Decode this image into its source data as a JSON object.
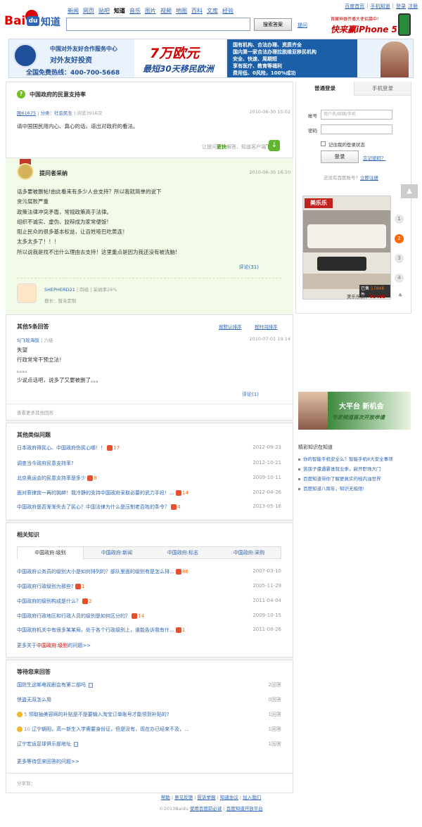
{
  "header": {
    "logo_text": "Bai",
    "logo_du": "du",
    "logo_zhidao": "知道",
    "nav": [
      "新闻",
      "网页",
      "贴吧",
      "知道",
      "音乐",
      "图片",
      "视频",
      "地图",
      "百科",
      "文库",
      "经验"
    ],
    "nav_current": "知道",
    "search_button": "搜索答案",
    "ask_link": "提问",
    "top_links": [
      "百度首页",
      "手机知道",
      "登录",
      "注册"
    ],
    "promo_line1": "首藏神器传播大使招募中!",
    "promo_line2": "快来赢iPhone 5"
  },
  "banner": {
    "line1": "中国对外友好合作服务中心",
    "line2": "对外友好投资",
    "hotline": "全国免费热线：400-700-5668",
    "big": "7万欧元",
    "sub": "最短30天移民欧洲",
    "right_lines": [
      "国有机构、合法办理、资质齐全",
      "国内第一家合法办理拉脱维亚移民机构",
      "安全、快速、周期短",
      "享有医疗、教育等福利",
      "费用低、0风险，100%成功"
    ]
  },
  "question": {
    "title": "中国政府的民意支持率",
    "asker": "刚61675",
    "category": "分类：社会民生",
    "views": "浏览3916次",
    "date": "2010-06-30 15:02",
    "body": "请中国国民用内心、真心的话，道出对政府的看法。",
    "prompt_prefix": "让提问",
    "prompt_fast": "更快",
    "prompt_mid": "解答，知道客户端",
    "prompt_download": "下载"
  },
  "best_answer": {
    "label": "提问者采纳",
    "date": "2010-06-30 16:10",
    "lines": [
      "话多要被删帖!由此看来有多少人会支持？所以我就简单的说下",
      "贪污腐败严重",
      "政策法律冲突矛盾，常规政策高于法律。",
      "组织不诚实、虚伪、狡辩成为家常便饭!",
      "阻止民众的很多基本权益，让百姓哑巴吃黄连！",
      "太多太多了！！！",
      "所以说我是找不出什么理由去支持！这里重点是因为我还没有被洗脑!"
    ],
    "comments": "评论(31)",
    "user": "SHEPHERD21",
    "level": "四级",
    "accept_rate": "采纳率26%",
    "specialty": "擅长：暂未定制"
  },
  "other_answers": {
    "title": "其他5条回答",
    "sort1": "按默认排序",
    "sort2": "按时间排序",
    "user": "SJ飞轮海饭",
    "level": "六级",
    "date": "2010-07-01 19:14",
    "lines": [
      "失望",
      "行政常常干预立法！",
      "。。。。",
      "少说点话吧，说多了又要被删了。。。"
    ],
    "comments": "评论(1)",
    "more": "查看更多其他回答"
  },
  "similar": {
    "title": "其他类似问题",
    "items": [
      {
        "text": "日本政府得民心、中国政府伤民心哪！！",
        "count": "17",
        "date": "2012-09-23"
      },
      {
        "text": "调查当今政府民意支持率?",
        "count": "",
        "date": "2012-10-21"
      },
      {
        "text": "北京奥运会的民意支持率是多少",
        "count": "8",
        "date": "2009-10-11"
      },
      {
        "text": "面对菲律宾一再的挑衅！我冷静的支持中国政府采取必要的武力手段！...",
        "count": "14",
        "date": "2012-04-26"
      },
      {
        "text": "中国政府是否渐渐失去了民心？中国法律为什么是压制老百姓的条令？",
        "count": "4",
        "date": "2013-05-16"
      }
    ]
  },
  "related": {
    "title": "相关知识",
    "tabs": [
      "中国政府:级别",
      "中国政府:新闻",
      "中国政府:标志",
      "中国政府:采购"
    ],
    "items": [
      {
        "text": "中国政府公务员的级别大小是如何排列的？部队里面的级别有是怎么排...",
        "count": "86",
        "date": "2007-03-10"
      },
      {
        "text": "中国政府行政级别为那些?",
        "count": "1",
        "date": "2005-11-29"
      },
      {
        "text": "中国政府的级别构成是什么？",
        "count": "2",
        "date": "2011-04-04"
      },
      {
        "text": "中国政府行政地区和行政人员的级别是如何区分的？",
        "count": "14",
        "date": "2009-10-15"
      },
      {
        "text": "中国政府机关中有很多某某局，处于各个行政级别上，谁能告诉我有什...",
        "count": "1",
        "date": "2011-08-26"
      }
    ],
    "more_prefix": "更多关于",
    "more_keyword": "中国政府:级别",
    "more_suffix": "的问题>>"
  },
  "pending": {
    "title": "等待您来回答",
    "items": [
      {
        "coin": "",
        "text": "国防生这邮电视剧会有第二部吗",
        "answers": "2回答"
      },
      {
        "coin": "",
        "text": "侠盗无双怎么用",
        "answers": "0回答"
      },
      {
        "coin": "5",
        "text": "领取抽美容网的补贴是不是要输入淘宝订单账号才能领到补贴的?",
        "answers": "1回答"
      },
      {
        "coin": "10",
        "text": "辽宁朝阳，高一新生入学需要身份证，但是没有，现在办已经来不及，...",
        "answers": "1回答"
      },
      {
        "coin": "",
        "text": "辽宁宏运足球俱乐部地址",
        "answers": "1回答"
      }
    ],
    "more": "更多等待您来回答的问题>>"
  },
  "share_label": "分享到：",
  "sidebar": {
    "tab_login": "普通登录",
    "tab_mobile": "手机登录",
    "label_account": "帐号",
    "placeholder_account": "用户名/邮箱/手机",
    "label_password": "密码",
    "remember": "记住我的登录状态",
    "login_button": "登录",
    "forgot": "忘记密码？",
    "no_account": "还没有百度账号？",
    "register": "立即注册",
    "ad_brand": "美乐乐",
    "ad_sold": "已售",
    "ad_sold_count": "17848",
    "ad_sold_unit": "件",
    "ad_price_label": "美乐乐价：",
    "ad_price": "¥5499",
    "carousel": [
      "1",
      "2",
      "3",
      "4"
    ],
    "carousel_active": "2",
    "ad2_line1": "大平台 新机会",
    "ad2_line2": "专家频道首次开放申请",
    "knowledge_title": "精彩知识在知道",
    "knowledge": [
      "你的智能手机安全么？智能手机8大安全事项",
      "苦孩子遭遇暴谁就业季，敲开职场大门",
      "百度知道带你了解更真实的桂内油世界",
      "百度知道八周年，知识无极限!"
    ]
  },
  "footer": {
    "links": [
      "帮助",
      "意见反馈",
      "投诉举报",
      "知道协议",
      "加入我们"
    ],
    "copyright": "©2013Baidu",
    "use_before": "使用百度前必读",
    "open_platform": "百度知道开放平台"
  },
  "colors": {
    "link": "#2d64b3",
    "accent": "#f60",
    "green_bg": "#f2fbe8",
    "red": "#c00"
  }
}
